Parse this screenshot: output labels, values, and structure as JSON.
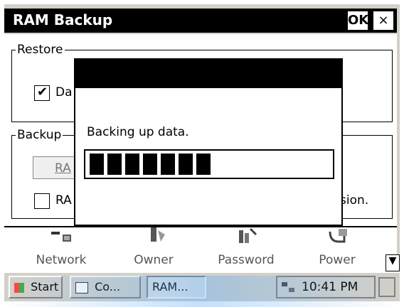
{
  "window": {
    "title": "RAM Backup",
    "ok_label": "OK",
    "close_label": "×"
  },
  "restore_group": {
    "label": "Restore",
    "checkbox_checked": true,
    "checkbox_label_visible": "Da"
  },
  "backup_group": {
    "label": "Backup",
    "button_label_visible": "RA",
    "checkbox_label_visible": "RA",
    "right_text_visible": "sion."
  },
  "progress_dialog": {
    "title": "",
    "message": "Backing up data.",
    "progress_blocks_filled": 7,
    "progress_blocks_total": 13,
    "progress_fraction": 0.54
  },
  "control_panel": {
    "items": [
      {
        "label": "Network",
        "icon": "network-icon"
      },
      {
        "label": "Owner",
        "icon": "owner-icon"
      },
      {
        "label": "Password",
        "icon": "password-icon"
      },
      {
        "label": "Power",
        "icon": "power-icon"
      }
    ],
    "scroll_down_icon": "triangle-down-icon"
  },
  "taskbar": {
    "start_label": "Start",
    "tasks": [
      {
        "label": "Co...",
        "state": "raised",
        "icon": "control-panel-icon"
      },
      {
        "label": "RAM...",
        "state": "pressed"
      }
    ],
    "time": "10:41 PM",
    "keyboard_icon": "keyboard-icon"
  }
}
